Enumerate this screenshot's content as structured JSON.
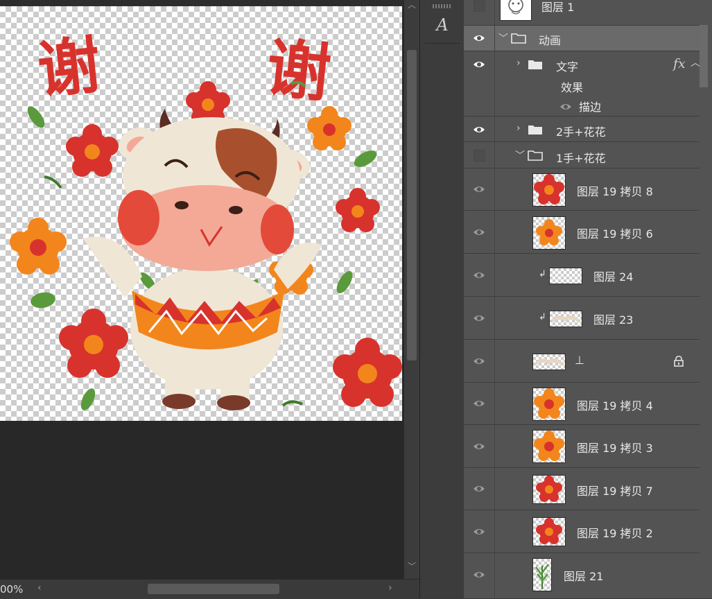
{
  "canvas": {
    "zoom_text": "00%",
    "artwork_title_chars": [
      "谢",
      "谢"
    ],
    "colors": {
      "red": "#d8322d",
      "orange": "#f2861c",
      "cream": "#f0e6d6",
      "leaf": "#5a9a3c"
    }
  },
  "scrollbars": {
    "up": "︿",
    "down": "﹀",
    "left": "‹",
    "right": "›"
  },
  "toolstrip": {
    "char_icon": "A"
  },
  "layers": [
    {
      "id": "layer1",
      "label": "图层 1",
      "visible": false,
      "thumb": "cow"
    },
    {
      "id": "anim",
      "label": "动画",
      "visible": true,
      "group": true,
      "expanded": true,
      "selected": true
    },
    {
      "id": "text",
      "label": "文字",
      "visible": true,
      "group": true,
      "expanded": false,
      "fx": "fx",
      "effects_label": "效果",
      "effect_item": "描边"
    },
    {
      "id": "hand2",
      "label": "2手+花花",
      "visible": true,
      "group": true,
      "expanded": false
    },
    {
      "id": "hand1",
      "label": "1手+花花",
      "visible": false,
      "group": true,
      "expanded": true
    },
    {
      "id": "c8",
      "label": "图层 19 拷贝 8",
      "visible": true,
      "thumb": "red"
    },
    {
      "id": "c6",
      "label": "图层 19 拷贝 6",
      "visible": true,
      "thumb": "orange"
    },
    {
      "id": "l24",
      "label": "图层 24",
      "visible": true,
      "clip": true,
      "thumb": "blank"
    },
    {
      "id": "l23",
      "label": "图层 23",
      "visible": true,
      "clip": true,
      "thumb": "arm"
    },
    {
      "id": "l1",
      "label": "⊥",
      "visible": true,
      "thumb": "arm",
      "locked": true
    },
    {
      "id": "c4",
      "label": "图层 19 拷贝 4",
      "visible": true,
      "thumb": "orange"
    },
    {
      "id": "c3",
      "label": "图层 19 拷贝 3",
      "visible": true,
      "thumb": "orange"
    },
    {
      "id": "c7",
      "label": "图层 19 拷贝 7",
      "visible": true,
      "thumb": "red"
    },
    {
      "id": "c2",
      "label": "图层 19 拷贝 2",
      "visible": true,
      "thumb": "red"
    },
    {
      "id": "l21",
      "label": "图层 21",
      "visible": true,
      "thumb": "plant"
    }
  ]
}
